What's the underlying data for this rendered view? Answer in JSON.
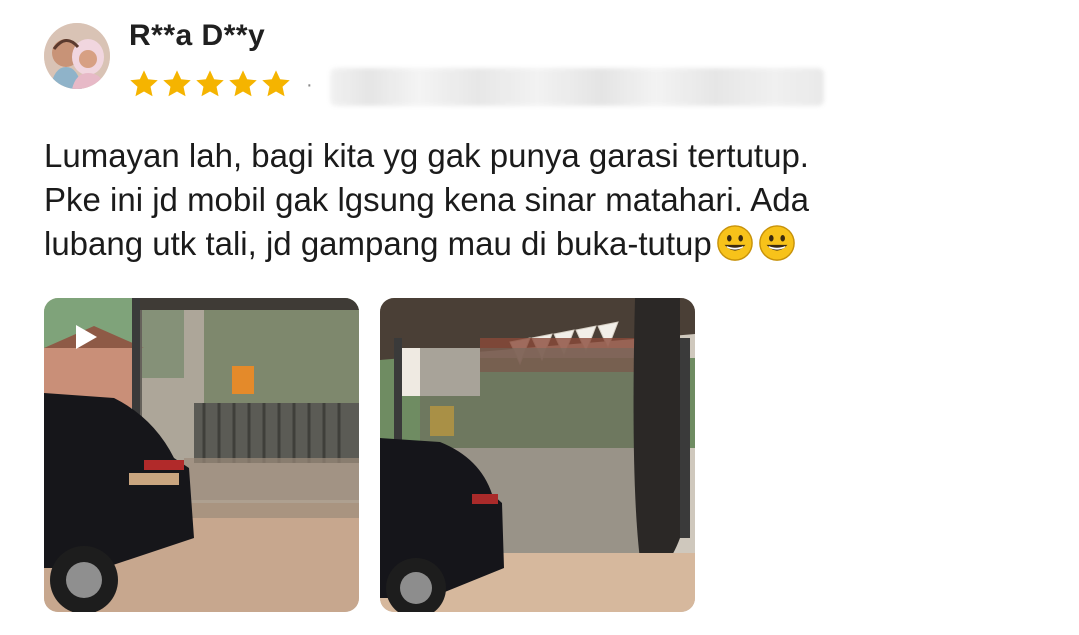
{
  "review": {
    "reviewer_name": "R**a D**y",
    "rating": 5,
    "rating_max": 5,
    "separator": "·",
    "text_lines": [
      "Lumayan lah, bagi kita yg gak punya garasi tertutup.",
      "Pke ini jd mobil gak lgsung kena sinar matahari. Ada",
      "lubang utk tali, jd gampang mau di buka-tutup"
    ],
    "emojis": [
      "grinning-face-icon",
      "grinning-face-icon"
    ],
    "media": [
      {
        "kind": "video",
        "icon": "play-icon"
      },
      {
        "kind": "photo"
      }
    ]
  },
  "colors": {
    "star": "#F5B400",
    "emoji_face": "#F7C21A",
    "text": "#1b1b1b",
    "name": "#202020"
  }
}
